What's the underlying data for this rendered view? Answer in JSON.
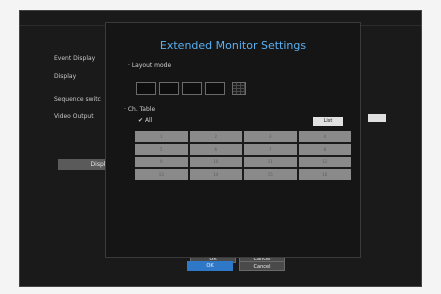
{
  "background": {
    "menu": [
      {
        "label": "Event Display"
      },
      {
        "label": "Display"
      },
      {
        "label": "Sequence switc"
      },
      {
        "label": "Video Output"
      }
    ],
    "display_button": "Displ",
    "small_button": "",
    "ok_label": "OK",
    "cancel_label": "Cancel"
  },
  "dialog": {
    "title": "Extended Monitor Settings",
    "layout_mode_label": "Layout mode",
    "layout_options": [
      "1x1",
      "2x2",
      "3x3",
      "4x4",
      "5x5"
    ],
    "ch_table_label": "Ch. Table",
    "all_checkbox": {
      "label": "All",
      "checked": true
    },
    "list_label": "List",
    "channels": [
      "1",
      "2",
      "3",
      "4",
      "5",
      "6",
      "7",
      "8",
      "9",
      "10",
      "11",
      "12",
      "13",
      "14",
      "15",
      "16"
    ],
    "ok_label": "OK",
    "cancel_label": "Cancel"
  },
  "colors": {
    "accent": "#5ab0f0",
    "primary_button": "#2f78c8",
    "cell": "#8a8a8a"
  }
}
